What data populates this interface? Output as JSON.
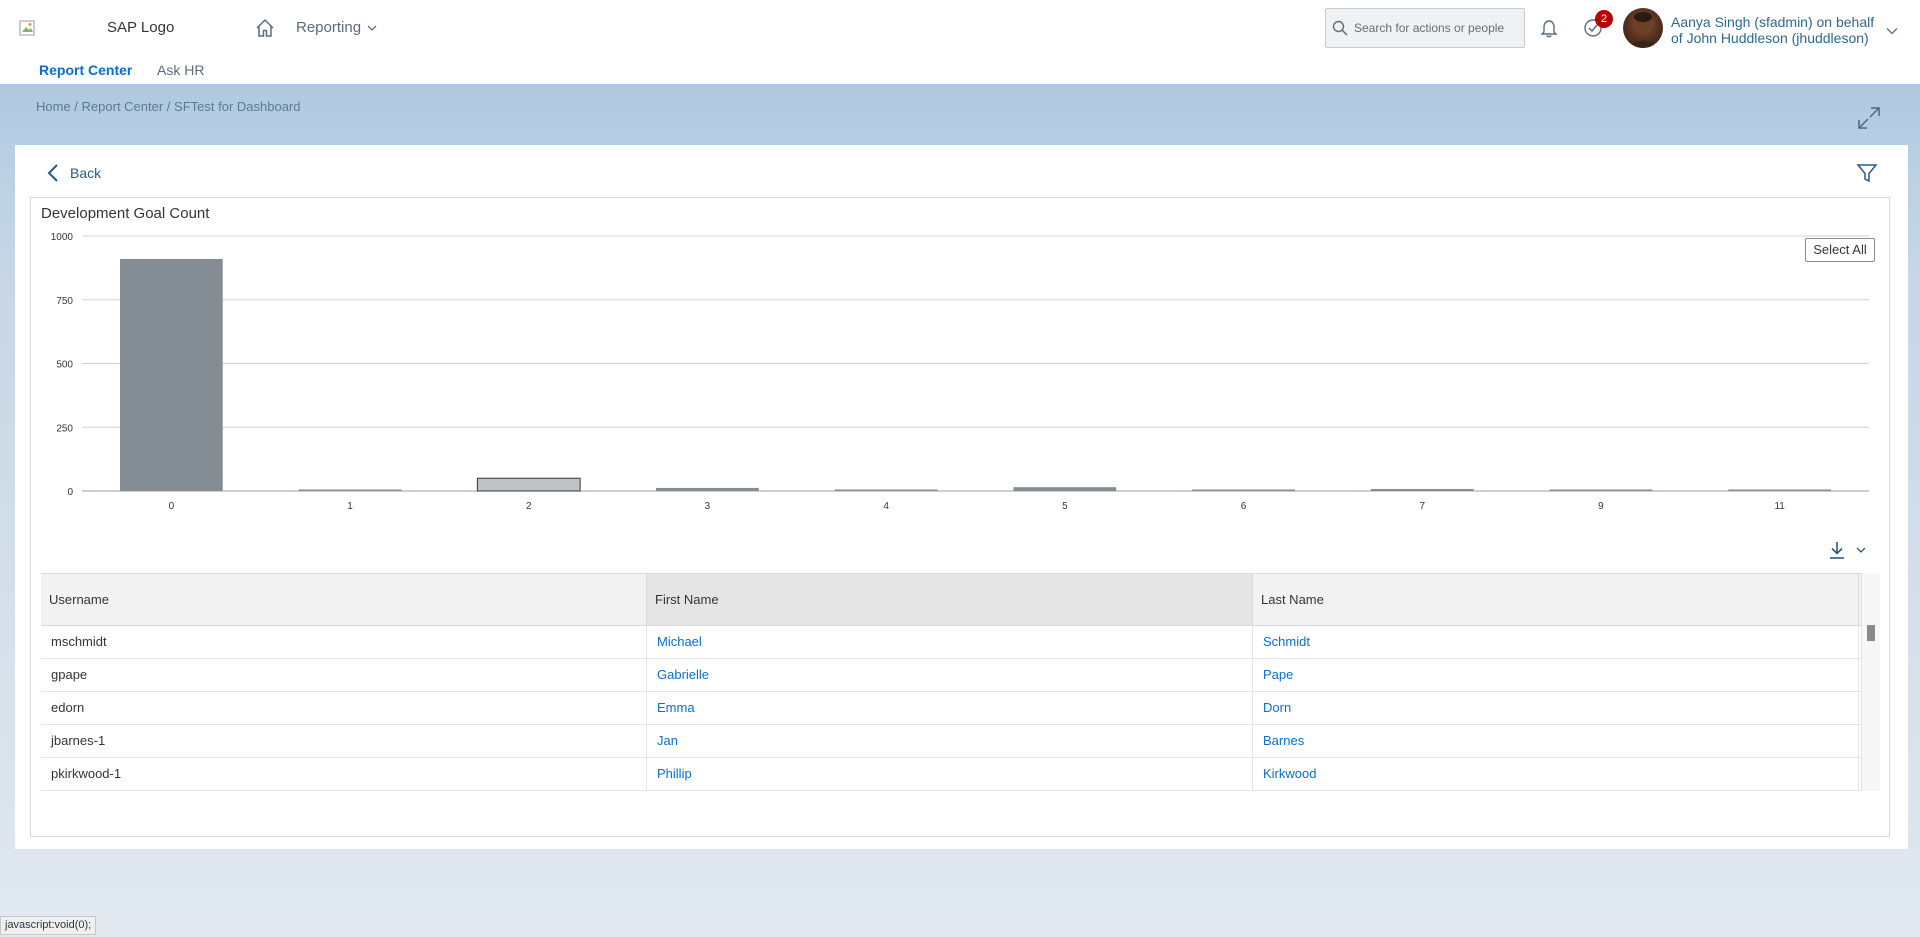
{
  "shell": {
    "logo_text": "SAP Logo",
    "nav_label": "Reporting",
    "search_placeholder": "Search for actions or people",
    "todo_badge": "2",
    "user_line1": "Aanya Singh (sfadmin) on behalf",
    "user_line2": "of John Huddleson (jhuddleson)"
  },
  "tabs": {
    "report_center": "Report Center",
    "ask_hr": "Ask HR"
  },
  "breadcrumb": {
    "home": "Home",
    "sep": " / ",
    "report_center": "Report Center",
    "current": "SFTest for Dashboard"
  },
  "page": {
    "back_label": "Back",
    "select_all": "Select All"
  },
  "chart_data": {
    "type": "bar",
    "title": "Development Goal Count",
    "categories": [
      "0",
      "1",
      "2",
      "3",
      "4",
      "5",
      "6",
      "7",
      "9",
      "11"
    ],
    "values": [
      910,
      2,
      50,
      12,
      2,
      15,
      3,
      8,
      2,
      2
    ],
    "highlighted_index": 2,
    "ylim": [
      0,
      1000
    ],
    "yticks": [
      "0",
      "250",
      "500",
      "750",
      "1000"
    ],
    "ytick_values": [
      0,
      250,
      500,
      750,
      1000
    ],
    "grid": true,
    "colors": {
      "bar": "#848d93",
      "selected": "#c0c3c5",
      "selected_border": "#32363a"
    }
  },
  "table": {
    "columns": [
      "Username",
      "First Name",
      "Last Name"
    ],
    "rows": [
      [
        "mschmidt",
        "Michael",
        "Schmidt"
      ],
      [
        "gpape",
        "Gabrielle",
        "Pape"
      ],
      [
        "edorn",
        "Emma",
        "Dorn"
      ],
      [
        "jbarnes-1",
        "Jan",
        "Barnes"
      ],
      [
        "pkirkwood-1",
        "Phillip",
        "Kirkwood"
      ]
    ]
  },
  "status_bar": "javascript:void(0);",
  "icons": [
    "logo-image-icon",
    "home-icon",
    "chevron-down-icon",
    "search-icon",
    "bell-icon",
    "todo-check-icon",
    "expand-icon",
    "back-arrow-icon",
    "filter-icon",
    "download-icon"
  ]
}
